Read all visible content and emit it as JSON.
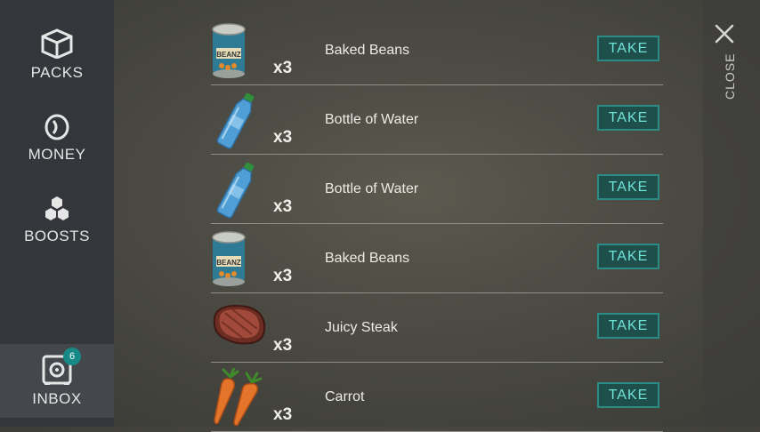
{
  "sidebar": {
    "items": [
      {
        "label": "PACKS",
        "icon": "box-icon"
      },
      {
        "label": "MONEY",
        "icon": "coin-icon"
      },
      {
        "label": "BOOSTS",
        "icon": "hexagons-icon"
      }
    ],
    "inbox": {
      "label": "INBOX",
      "icon": "inbox-safe-icon",
      "badge": "6"
    }
  },
  "close": {
    "label": "CLOSE",
    "icon": "close-x-icon"
  },
  "inbox_items": [
    {
      "name": "Baked Beans",
      "qty": "x3",
      "icon": "baked-beans-can-icon",
      "button": "TAKE"
    },
    {
      "name": "Bottle of Water",
      "qty": "x3",
      "icon": "water-bottle-icon",
      "button": "TAKE"
    },
    {
      "name": "Bottle of Water",
      "qty": "x3",
      "icon": "water-bottle-icon",
      "button": "TAKE"
    },
    {
      "name": "Baked Beans",
      "qty": "x3",
      "icon": "baked-beans-can-icon",
      "button": "TAKE"
    },
    {
      "name": "Juicy Steak",
      "qty": "x3",
      "icon": "steak-icon",
      "button": "TAKE"
    },
    {
      "name": "Carrot",
      "qty": "x3",
      "icon": "carrot-icon",
      "button": "TAKE"
    }
  ],
  "colors": {
    "accent": "#2c8b84",
    "button_text": "#6fe3d8",
    "sidebar": "#33363a",
    "badge": "#178a87"
  }
}
